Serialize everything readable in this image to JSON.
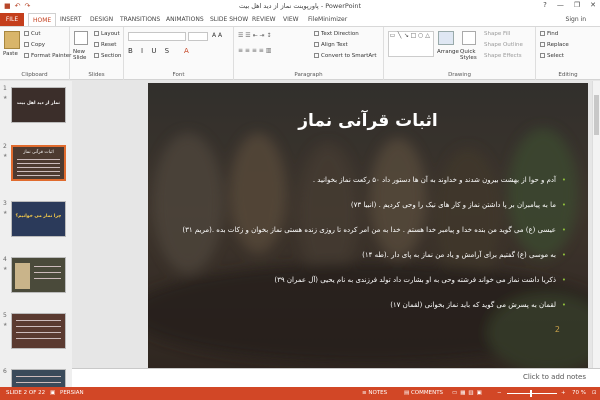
{
  "window": {
    "title": "پاورپوینت نماز از دید اهل بیت - PowerPoint",
    "controls": [
      "?",
      "—",
      "❐",
      "✕"
    ]
  },
  "tabs": [
    "FILE",
    "HOME",
    "INSERT",
    "DESIGN",
    "TRANSITIONS",
    "ANIMATIONS",
    "SLIDE SHOW",
    "REVIEW",
    "VIEW",
    "FileMinimizer"
  ],
  "account": {
    "label": "Sign in"
  },
  "ribbon": {
    "clipboard": {
      "paste": "Paste",
      "cut": "Cut",
      "copy": "Copy",
      "format_painter": "Format Painter",
      "group": "Clipboard"
    },
    "slides": {
      "new_slide": "New Slide",
      "layout": "Layout",
      "reset": "Reset",
      "section": "Section",
      "group": "Slides"
    },
    "font": {
      "group": "Font"
    },
    "paragraph": {
      "text_direction": "Text Direction",
      "align_text": "Align Text",
      "smartart": "Convert to SmartArt",
      "group": "Paragraph"
    },
    "drawing": {
      "arrange": "Arrange",
      "quick_styles": "Quick Styles",
      "shape_fill": "Shape Fill",
      "shape_outline": "Shape Outline",
      "shape_effects": "Shape Effects",
      "group": "Drawing"
    },
    "editing": {
      "find": "Find",
      "replace": "Replace",
      "select": "Select",
      "group": "Editing"
    }
  },
  "thumbnails": [
    {
      "num": "1",
      "title": "نماز از دید اهل بیت"
    },
    {
      "num": "2",
      "title": "اثبات قرآنی نماز"
    },
    {
      "num": "3",
      "title": "چرا نماز می خوانیم؟"
    },
    {
      "num": "4",
      "title": ""
    },
    {
      "num": "5",
      "title": ""
    },
    {
      "num": "6",
      "title": ""
    }
  ],
  "slide": {
    "title": "اثبات قرآنی نماز",
    "bullets": [
      "آدم و حوا از بهشت بیرون شدند و خداوند به آن ها دستور داد ۵۰ رکعت نماز بخوانید .",
      "ما به پیامبران بر پا داشتن نماز و کار های نیک را وحی کردیم . (انبیا ۷۳)",
      "عیسی (ع) می گوید من بنده خدا و پیامبر خدا هستم . خدا به من امر کرده تا روزی زنده هستی نماز بخوان و زکات بده .(مریم ۳۱)",
      "به موسی (ع) گفتیم برای آرامش و یاد من نماز به پای دار .(طه ۱۴)",
      "ذکریا داشت نماز می خواند فرشته وحی به او بشارت داد تولد فرزندی به نام یحیی (آل عمران ۳۹)",
      "لقمان به پسرش می گوید که باید نماز بخوانی (لقمان ۱۷)"
    ],
    "number": "2"
  },
  "notes": {
    "placeholder": "Click to add notes"
  },
  "status": {
    "slide_counter": "SLIDE 2 OF 22",
    "language": "PERSIAN",
    "notes": "NOTES",
    "comments": "COMMENTS",
    "zoom": "70 %"
  },
  "colors": {
    "accent": "#c43e1c",
    "statusbar": "#d24726",
    "bullet": "#8fbf3b"
  }
}
